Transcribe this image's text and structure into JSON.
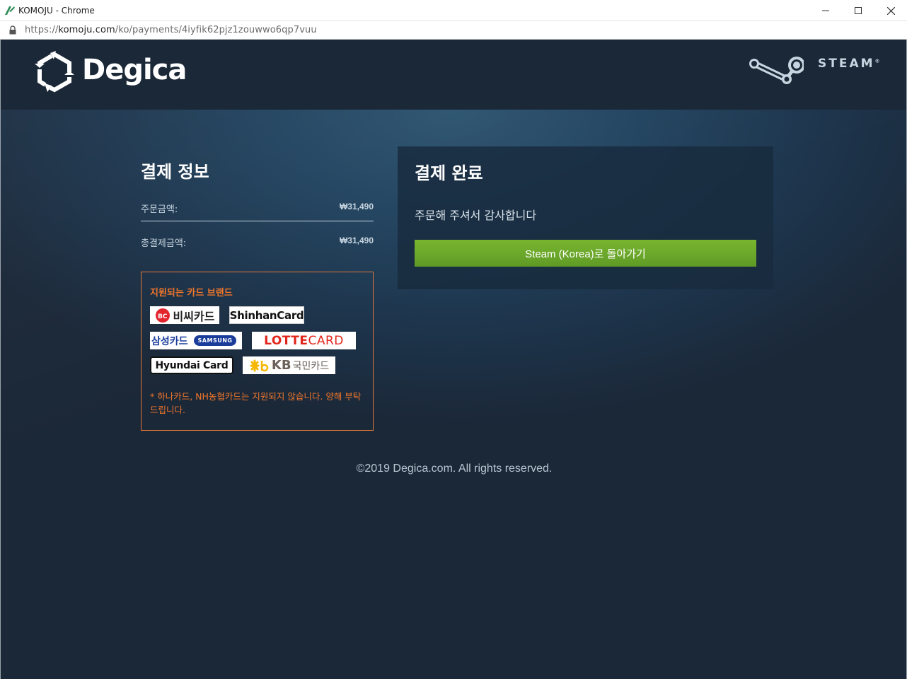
{
  "browser": {
    "window_title": "KOMOJU - Chrome",
    "url_prefix": "https://",
    "url_host": "komoju.com",
    "url_path": "/ko/payments/4iyfik62pjz1zouwwo6qp7vuu"
  },
  "header": {
    "brand_name": "Degica",
    "partner_name": "STEAM",
    "partner_mark": "®"
  },
  "payment_info": {
    "title": "결제 정보",
    "rows": [
      {
        "label": "주문금액:",
        "value": "₩31,490"
      },
      {
        "label": "총결제금액:",
        "value": "₩31,490"
      }
    ]
  },
  "card_brands": {
    "title": "지원되는 카드 브랜드",
    "brands": [
      {
        "name": "비씨카드"
      },
      {
        "name": "ShinhanCard"
      },
      {
        "name": "삼성카드",
        "sub": "SAMSUNG"
      },
      {
        "name": "LOTTE",
        "sub": "CARD"
      },
      {
        "name": "Hyundai Card"
      },
      {
        "name": "KB",
        "sub": "국민카드"
      }
    ],
    "note": "* 하나카드, NH농협카드는 지원되지 않습니다. 양해 부탁드립니다."
  },
  "complete": {
    "title": "결제 완료",
    "message": "주문해 주셔서 감사합니다",
    "button_label": "Steam (Korea)로 돌아가기"
  },
  "footer": {
    "copyright": "©2019 Degica.com. All rights reserved."
  },
  "colors": {
    "background": "#1b2838",
    "accent_orange": "#f0762b",
    "button_green": "#6aa62a"
  }
}
